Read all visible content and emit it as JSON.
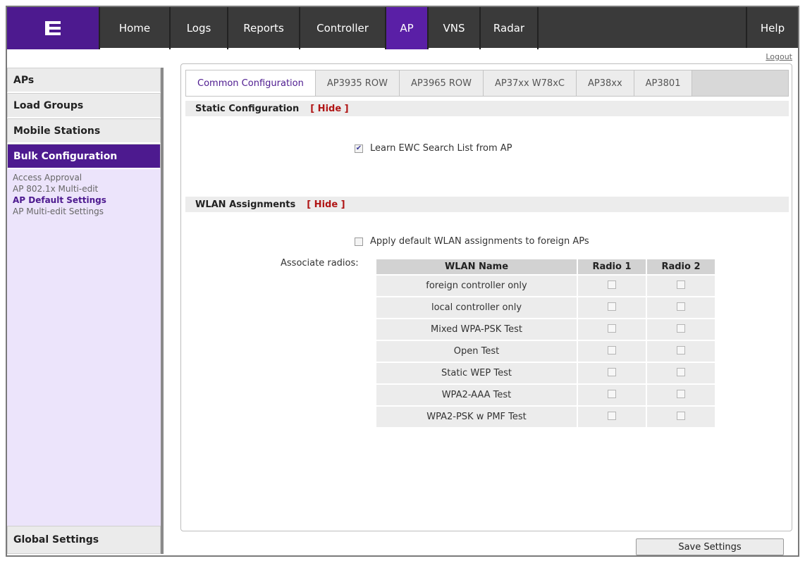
{
  "nav": {
    "logo_icon": "extreme-networks-logo",
    "items": [
      {
        "label": "Home",
        "width": 100
      },
      {
        "label": "Logs",
        "width": 82
      },
      {
        "label": "Reports",
        "width": 102
      },
      {
        "label": "Controller",
        "width": 122
      },
      {
        "label": "AP",
        "width": 60
      },
      {
        "label": "VNS",
        "width": 74
      },
      {
        "label": "Radar",
        "width": 82
      }
    ],
    "help_label": "Help",
    "active": "AP"
  },
  "logout_label": "Logout",
  "sidebar": {
    "sections": [
      "APs",
      "Load Groups",
      "Mobile Stations"
    ],
    "active_section": "Bulk Configuration",
    "links": [
      "Access Approval",
      "AP 802.1x Multi-edit",
      "AP Default Settings",
      "AP Multi-edit Settings"
    ],
    "active_link": "AP Default Settings",
    "bottom_section": "Global Settings"
  },
  "tabs": [
    "Common Configuration",
    "AP3935 ROW",
    "AP3965 ROW",
    "AP37xx W78xC",
    "AP38xx",
    "AP3801"
  ],
  "active_tab": "Common Configuration",
  "static_config": {
    "title": "Static Configuration",
    "hide_label": "[ Hide ]",
    "learn_ewc_label": "Learn EWC Search List from AP",
    "learn_ewc_checked": true
  },
  "wlan_assignments": {
    "title": "WLAN Assignments",
    "hide_label": "[ Hide ]",
    "apply_default_label": "Apply default WLAN assignments to foreign APs",
    "apply_default_checked": false,
    "associate_label": "Associate radios:",
    "columns": [
      "WLAN Name",
      "Radio 1",
      "Radio 2"
    ],
    "rows": [
      {
        "name": "foreign controller only",
        "radio1": false,
        "radio2": false
      },
      {
        "name": "local controller only",
        "radio1": false,
        "radio2": false
      },
      {
        "name": "Mixed WPA-PSK Test",
        "radio1": false,
        "radio2": false
      },
      {
        "name": "Open Test",
        "radio1": false,
        "radio2": false
      },
      {
        "name": "Static WEP Test",
        "radio1": false,
        "radio2": false
      },
      {
        "name": "WPA2-AAA Test",
        "radio1": false,
        "radio2": false
      },
      {
        "name": "WPA2-PSK w PMF Test",
        "radio1": false,
        "radio2": false
      }
    ]
  },
  "save_label": "Save Settings",
  "colors": {
    "brand": "#4d1a8f",
    "hide_link": "#b01515"
  }
}
